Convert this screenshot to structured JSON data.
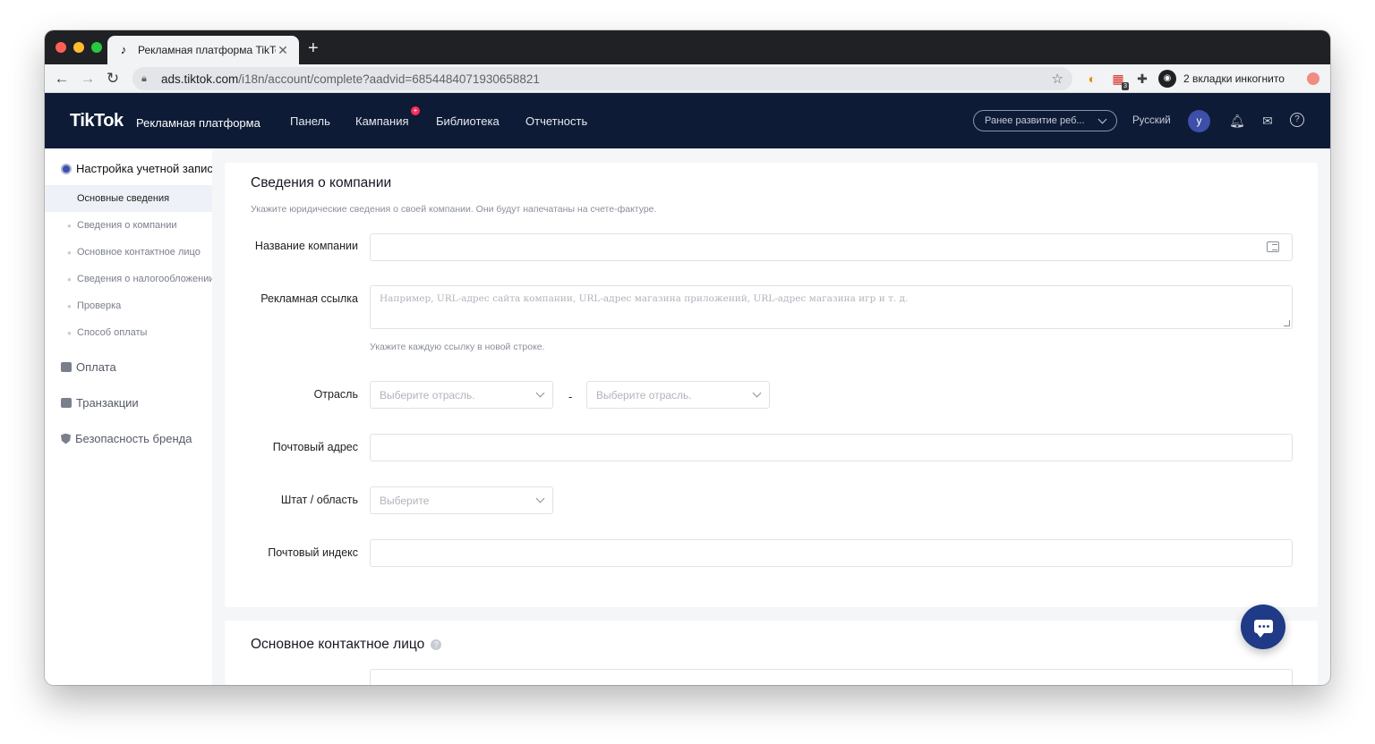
{
  "browser": {
    "tab_title": "Рекламная платформа TikTok",
    "tab_favicon": "♪",
    "tab_close": "✕",
    "new_tab": "+",
    "url_host": "ads.tiktok.com",
    "url_path": "/i18n/account/complete?aadvid=6854484071930658821",
    "incognito_label": "2 вкладки инкогнито",
    "extension_badge": "3"
  },
  "header": {
    "logo": "TikTok",
    "logo_sub": "Рекламная платформа",
    "menu": [
      "Панель",
      "Кампания",
      "Библиотека",
      "Отчетность"
    ],
    "campaign_badge": "+",
    "account_select": "Ранее развитие реб...",
    "language": "Русский",
    "avatar_letter": "y"
  },
  "sidebar": {
    "heading": "Настройка учетной записи",
    "items": [
      {
        "label": "Основные сведения",
        "active": true
      },
      {
        "label": "Сведения о компании",
        "active": false
      },
      {
        "label": "Основное контактное лицо",
        "active": false
      },
      {
        "label": "Сведения о налогообложении",
        "active": false
      },
      {
        "label": "Проверка",
        "active": false
      },
      {
        "label": "Способ оплаты",
        "active": false
      }
    ],
    "groups": [
      "Оплата",
      "Транзакции",
      "Безопасность бренда"
    ]
  },
  "company_section": {
    "title": "Сведения о компании",
    "description": "Укажите юридические сведения о своей компании. Они будут напечатаны на счете-фактуре.",
    "company_name_label": "Название компании",
    "company_name_value": "",
    "ad_link_label": "Рекламная ссылка",
    "ad_link_placeholder": "Например, URL-адрес сайта компании, URL-адрес магазина приложений, URL-адрес магазина игр и т. д.",
    "ad_link_hint": "Укажите каждую ссылку в новой строке.",
    "industry_label": "Отрасль",
    "industry_placeholder_1": "Выберите отрасль.",
    "industry_separator": "-",
    "industry_placeholder_2": "Выберите отрасль.",
    "postal_address_label": "Почтовый адрес",
    "postal_address_value": "",
    "state_label": "Штат / область",
    "state_placeholder": "Выберите",
    "postal_code_label": "Почтовый индекс",
    "postal_code_value": ""
  },
  "contact_section": {
    "title": "Основное контактное лицо",
    "help": "?"
  }
}
